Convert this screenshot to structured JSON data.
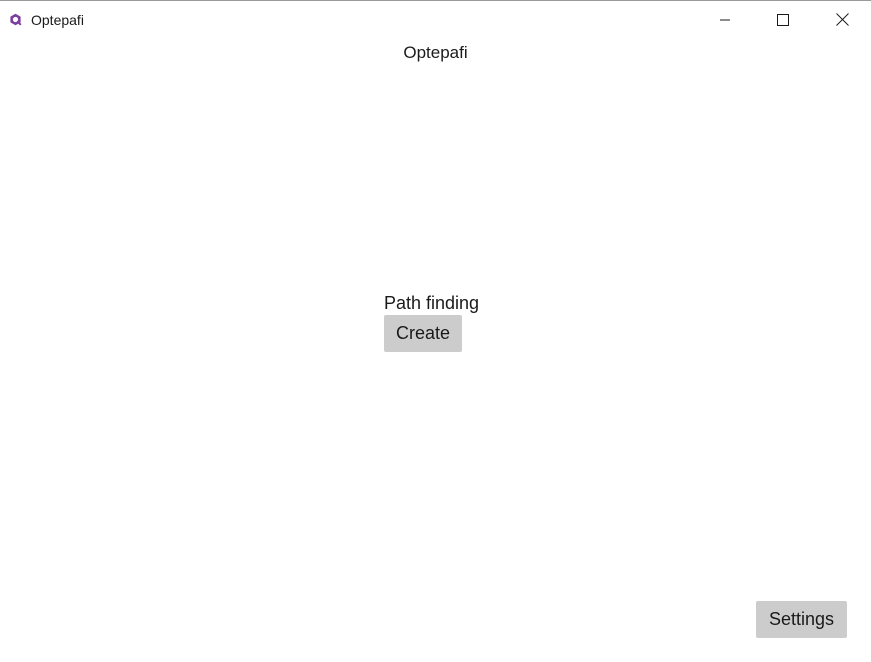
{
  "window": {
    "title": "Optepafi",
    "icon": "app-logo-icon",
    "accent_color": "#7b3fa0",
    "controls": {
      "minimize": "minimize-icon",
      "maximize": "maximize-icon",
      "close": "close-icon"
    }
  },
  "main": {
    "heading": "Optepafi",
    "section_label": "Path finding",
    "create_label": "Create"
  },
  "footer": {
    "settings_label": "Settings"
  },
  "colors": {
    "button_background": "#cccccc",
    "text": "#1a1a1a",
    "background": "#ffffff"
  }
}
